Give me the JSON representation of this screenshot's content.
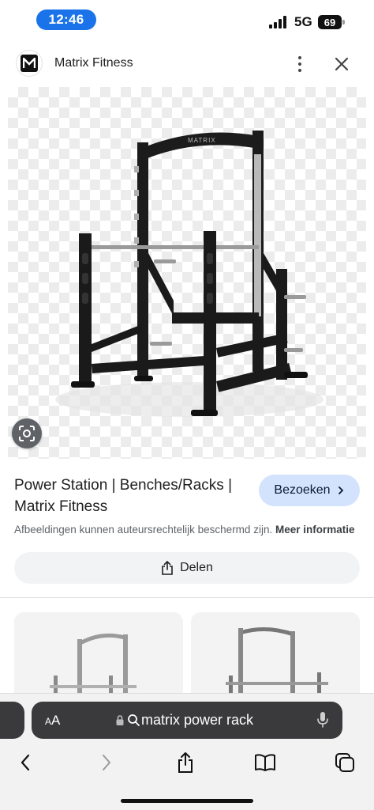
{
  "status": {
    "time": "12:46",
    "network": "5G",
    "battery": "69"
  },
  "header": {
    "site_name": "Matrix Fitness",
    "logo_icon": "matrix-m-logo",
    "more_icon": "more-vert-icon",
    "close_icon": "close-icon"
  },
  "image": {
    "alt": "Matrix power rack",
    "brand_text": "MATRIX"
  },
  "result": {
    "title": "Power Station | Benches/Racks | Matrix Fitness",
    "visit_label": "Bezoeken",
    "copyright_text": "Afbeeldingen kunnen auteursrechtelijk beschermd zijn.",
    "more_info_label": "Meer informatie",
    "share_label": "Delen"
  },
  "browser": {
    "text_size_label_small": "A",
    "text_size_label_large": "A",
    "url": "matrix power rack"
  },
  "colors": {
    "accent": "#1a73e8",
    "visit_bg": "#d3e3fd",
    "address_bar": "#3a3a3c"
  }
}
